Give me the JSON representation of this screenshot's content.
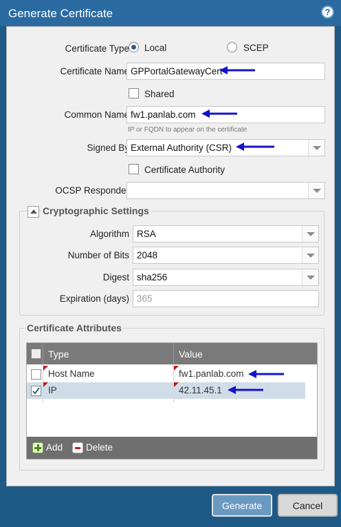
{
  "window": {
    "title": "Generate Certificate",
    "help_icon": "?"
  },
  "form": {
    "certificate_type": {
      "label": "Certificate Type",
      "options": [
        "Local",
        "SCEP"
      ],
      "selected": "Local"
    },
    "certificate_name": {
      "label": "Certificate Name",
      "value": "GPPortalGatewayCert"
    },
    "shared": {
      "label": "Shared",
      "checked": false
    },
    "common_name": {
      "label": "Common Name",
      "value": "fw1.panlab.com",
      "hint": "IP or FQDN to appear on the certificate"
    },
    "signed_by": {
      "label": "Signed By",
      "value": "External Authority (CSR)"
    },
    "certificate_authority": {
      "label": "Certificate Authority",
      "checked": false
    },
    "ocsp_responder": {
      "label": "OCSP Responder",
      "value": ""
    }
  },
  "crypto": {
    "title": "Cryptographic Settings",
    "algorithm": {
      "label": "Algorithm",
      "value": "RSA"
    },
    "bits": {
      "label": "Number of Bits",
      "value": "2048"
    },
    "digest": {
      "label": "Digest",
      "value": "sha256"
    },
    "expiration": {
      "label": "Expiration (days)",
      "placeholder": "365"
    }
  },
  "attributes": {
    "title": "Certificate Attributes",
    "columns": [
      "Type",
      "Value"
    ],
    "rows": [
      {
        "type": "Host Name",
        "value": "fw1.panlab.com",
        "checked": false
      },
      {
        "type": "IP",
        "value": "42.11.45.1",
        "checked": true
      }
    ],
    "add_label": "Add",
    "delete_label": "Delete"
  },
  "buttons": {
    "generate": "Generate",
    "cancel": "Cancel"
  },
  "colors": {
    "accent": "#2a6aa0",
    "arrow": "#1313c8",
    "flag": "#c21b1b"
  }
}
